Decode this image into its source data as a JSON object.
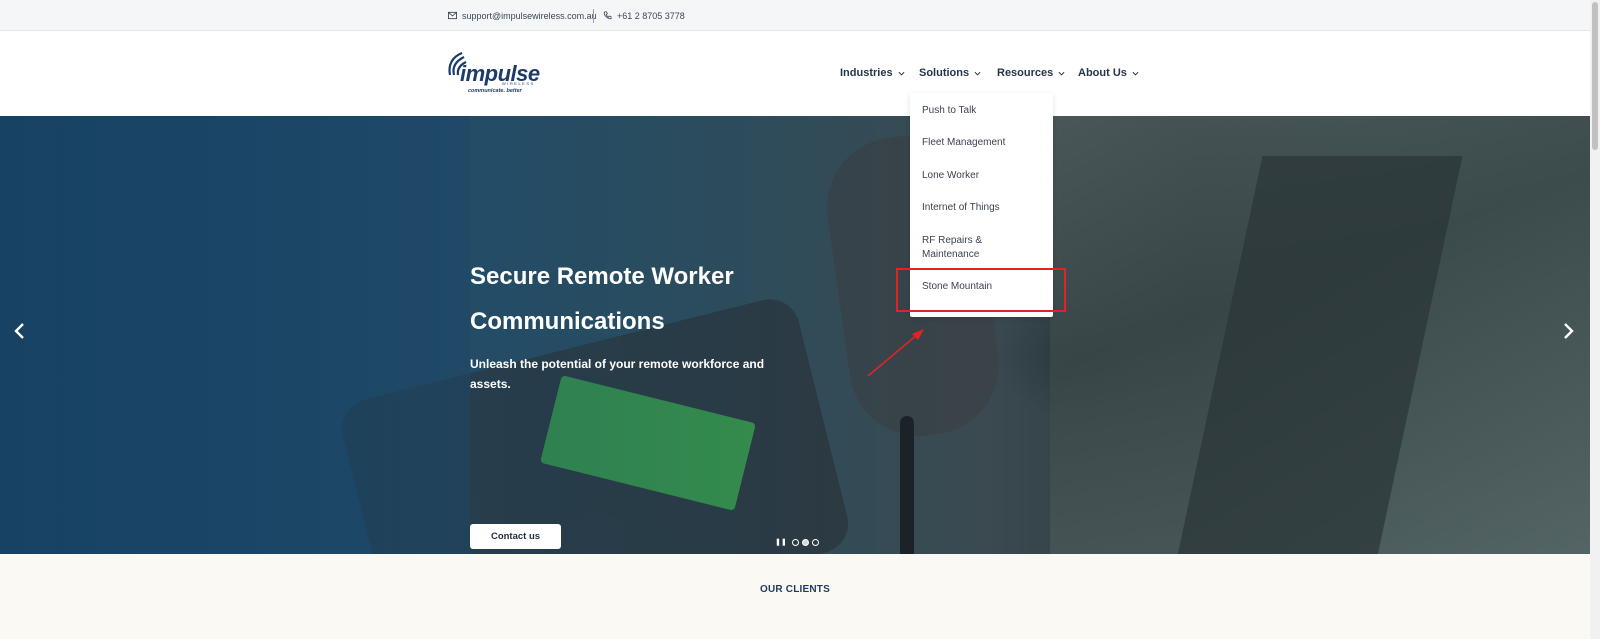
{
  "topbar": {
    "email": "support@impulsewireless.com.au",
    "phone": "+61 2 8705 3778",
    "email_icon": "envelope-icon",
    "phone_icon": "phone-icon"
  },
  "logo": {
    "word": "impulse",
    "sub": "WIRELESS",
    "tagline": "communicate. better"
  },
  "nav": {
    "items": [
      {
        "label": "Industries"
      },
      {
        "label": "Solutions"
      },
      {
        "label": "Resources"
      },
      {
        "label": "About Us"
      }
    ]
  },
  "dropdown": {
    "items": [
      {
        "label": "Push to Talk"
      },
      {
        "label": "Fleet Management"
      },
      {
        "label": "Lone Worker"
      },
      {
        "label": "Internet of Things"
      },
      {
        "label": "RF Repairs & Maintenance"
      },
      {
        "label": "Stone Mountain"
      }
    ]
  },
  "hero": {
    "title": "Secure Remote Worker Communications",
    "subtitle": "Unleash the potential of your remote workforce and assets.",
    "cta": "Contact us",
    "slides_total": 3,
    "active_slide": 2
  },
  "clients": {
    "title": "OUR CLIENTS"
  },
  "colors": {
    "brand": "#1c3b6a",
    "annotation": "#e02424"
  }
}
